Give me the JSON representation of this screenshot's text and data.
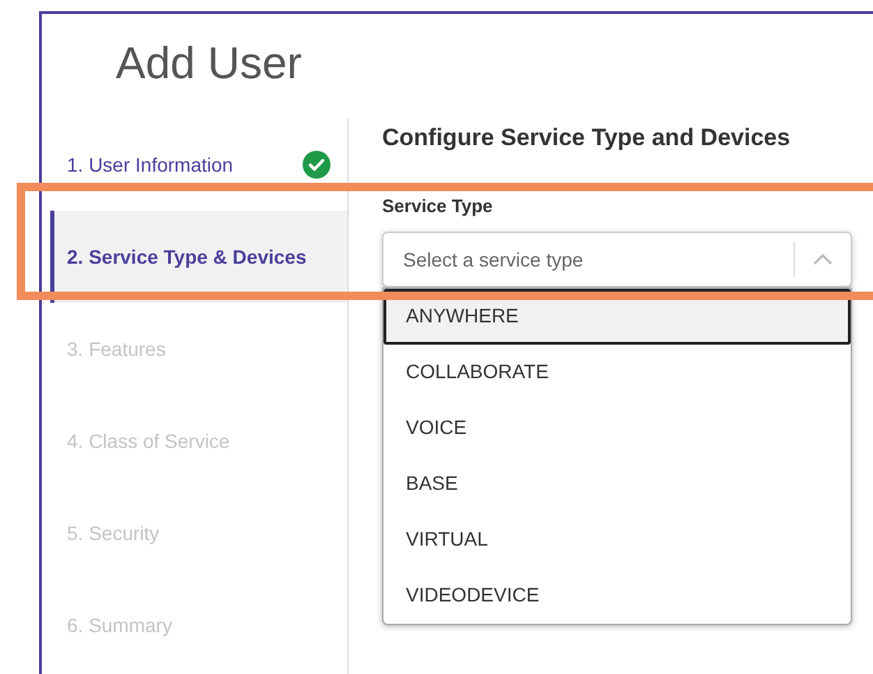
{
  "title": "Add User",
  "steps": [
    {
      "label": "1. User Information",
      "completed": true,
      "disabled": false,
      "selected": false
    },
    {
      "label": "2. Service Type & Devices",
      "completed": false,
      "disabled": false,
      "selected": true
    },
    {
      "label": "3. Features",
      "completed": false,
      "disabled": true,
      "selected": false
    },
    {
      "label": "4. Class of Service",
      "completed": false,
      "disabled": true,
      "selected": false
    },
    {
      "label": "5. Security",
      "completed": false,
      "disabled": true,
      "selected": false
    },
    {
      "label": "6. Summary",
      "completed": false,
      "disabled": true,
      "selected": false
    }
  ],
  "heading": "Configure Service Type and Devices",
  "service_type": {
    "label": "Service Type",
    "placeholder": "Select a service type",
    "expanded": true,
    "options": [
      {
        "label": "ANYWHERE",
        "selected": true
      },
      {
        "label": "COLLABORATE",
        "selected": false
      },
      {
        "label": "VOICE",
        "selected": false
      },
      {
        "label": "BASE",
        "selected": false
      },
      {
        "label": "VIRTUAL",
        "selected": false
      },
      {
        "label": "VIDEODEVICE",
        "selected": false
      }
    ]
  },
  "highlight_frame": true
}
